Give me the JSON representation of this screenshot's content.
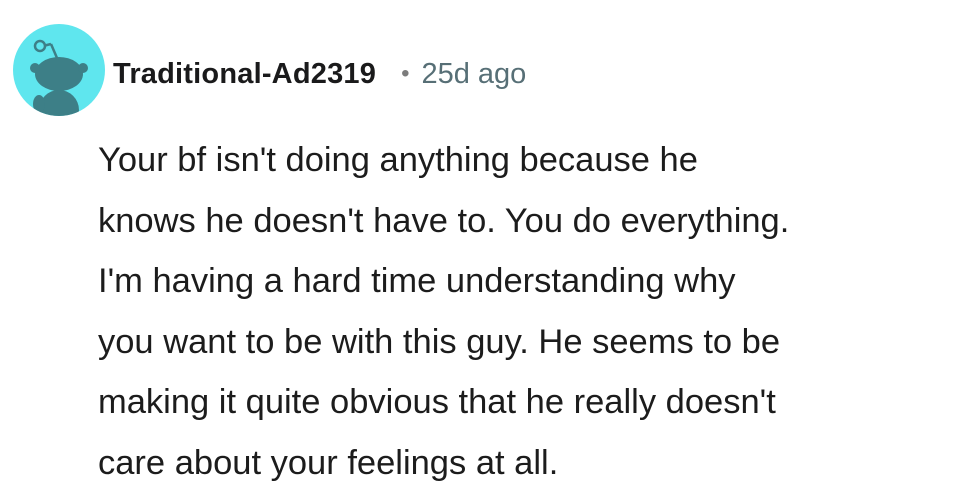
{
  "comment": {
    "avatar_icon": "snoo-avatar-icon",
    "avatar_color": "#5fe6ee",
    "username": "Traditional-Ad2319",
    "separator": "•",
    "timestamp": "25d ago",
    "body": "Your bf isn't doing anything because he\nknows he doesn't have to. You do everything.\nI'm having a hard time understanding why\nyou want to be with this guy. He seems to be\nmaking it quite obvious that he really doesn't\ncare about your feelings at all."
  }
}
